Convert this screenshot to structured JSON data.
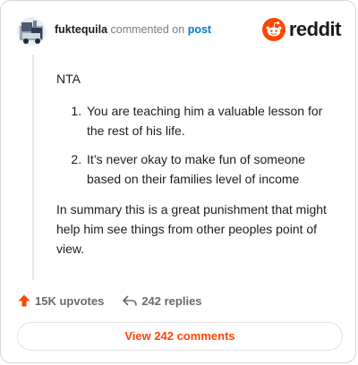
{
  "header": {
    "username": "fuktequila",
    "action_text": " commented on ",
    "post_link": "post"
  },
  "logo": {
    "wordmark": "reddit",
    "icon": "reddit-alien-icon",
    "brand_color": "#ff4500"
  },
  "comment": {
    "intro": "NTA",
    "points": [
      "You are teaching him a valuable lesson for the rest of his life.",
      "It’s never okay to make fun of someone based on their families level of income"
    ],
    "summary": "In summary this is a great punishment that might help him see things from other peoples point of view."
  },
  "actions": {
    "upvotes": {
      "icon": "upvote-arrow-icon",
      "label": "15K upvotes",
      "color": "#ff4500"
    },
    "replies": {
      "icon": "reply-arrow-icon",
      "label": "242 replies"
    }
  },
  "view_button": {
    "label": "View 242 comments"
  }
}
